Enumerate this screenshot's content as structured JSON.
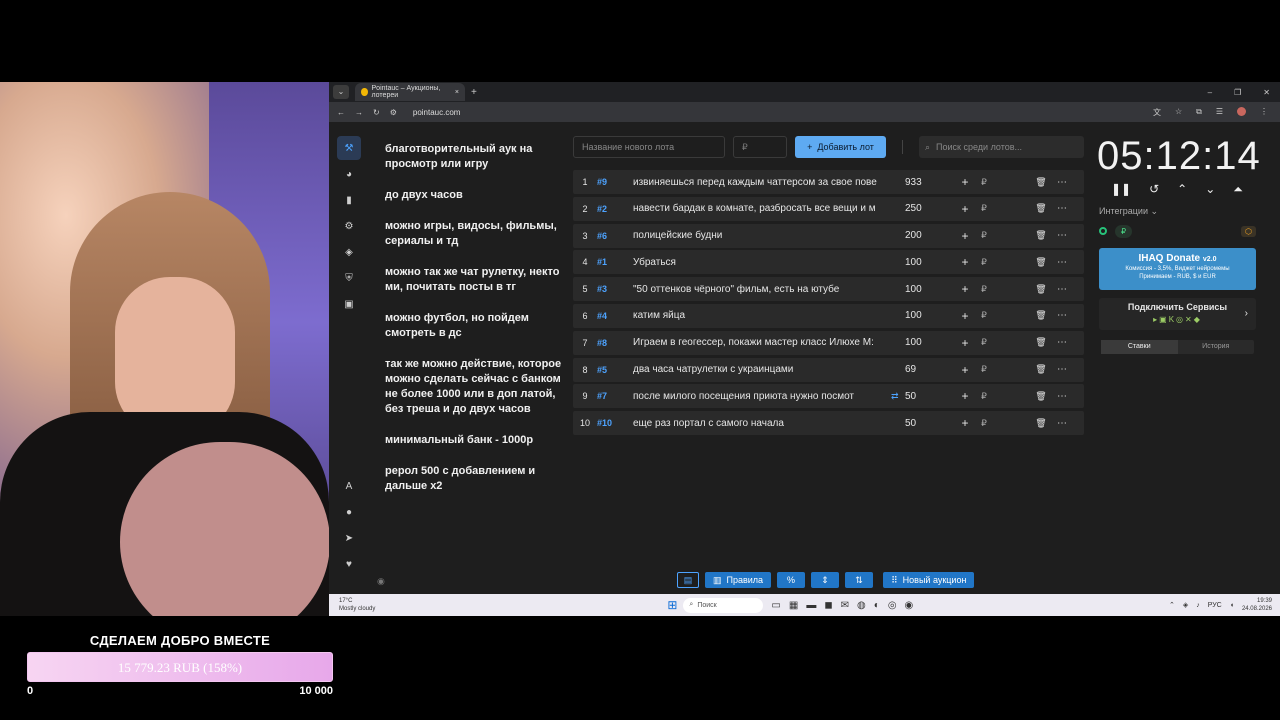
{
  "donation": {
    "title": "СДЕЛАЕМ ДОБРО ВМЕСТЕ",
    "progress_text": "15 779.23 RUB (158%)",
    "progress_percent": 158,
    "min": "0",
    "max": "10 000"
  },
  "browser": {
    "tab_title": "Pointauc – Аукционы, лотереи",
    "url": "pointauc.com"
  },
  "rules": [
    "благотворительный аук на просмотр или игру",
    "до  двух часов",
    "можно игры, видосы, фильмы, сериалы и тд",
    "можно так же чат рулетку, некто ми, почитать посты в тг",
    "можно футбол, но пойдем смотреть в дс",
    "так же можно действие, которое можно сделать сейчас с банком не более 1000 или в доп латой, без треша  и до двух часов",
    "минимальный банк - 1000р",
    "рерол 500 с добавлением и дальше х2"
  ],
  "controls": {
    "new_lot_placeholder": "Название нового лота",
    "price_placeholder": "₽",
    "add_label": "Добавить лот",
    "search_placeholder": "Поиск среди лотов..."
  },
  "lots": [
    {
      "idx": "1",
      "num": "#9",
      "name": "извиняешься перед каждым чаттерсом за свое пове",
      "amount": "933",
      "link": false
    },
    {
      "idx": "2",
      "num": "#2",
      "name": "навести бардак в комнате, разбросать все вещи и м",
      "amount": "250",
      "link": false
    },
    {
      "idx": "3",
      "num": "#6",
      "name": "полицейские будни",
      "amount": "200",
      "link": false
    },
    {
      "idx": "4",
      "num": "#1",
      "name": "Убраться",
      "amount": "100",
      "link": false
    },
    {
      "idx": "5",
      "num": "#3",
      "name": "\"50 оттенков чёрного\" фильм, есть на ютубе",
      "amount": "100",
      "link": false
    },
    {
      "idx": "6",
      "num": "#4",
      "name": "катим яйца",
      "amount": "100",
      "link": false
    },
    {
      "idx": "7",
      "num": "#8",
      "name": "Играем в геогессер, покажи мастер класс Илюхе М:",
      "amount": "100",
      "link": false
    },
    {
      "idx": "8",
      "num": "#5",
      "name": "два часа чатрулетки с украинцами",
      "amount": "69",
      "link": false
    },
    {
      "idx": "9",
      "num": "#7",
      "name": "после милого посещения приюта нужно посмот",
      "amount": "50",
      "link": true
    },
    {
      "idx": "10",
      "num": "#10",
      "name": "еще раз портал с самого начала",
      "amount": "50",
      "link": false
    }
  ],
  "timer": "05:12:14",
  "integrations": {
    "label": "Интеграции",
    "donate_title": "IHAQ Donate",
    "donate_version": "v2.0",
    "donate_line1": "Комиссия - 3,5%, Виджет нейромемы",
    "donate_line2": "Принимаем - RUB, $ и EUR",
    "connect_title": "Подключить Сервисы",
    "tab_bets": "Ставки",
    "tab_history": "История"
  },
  "footer": {
    "rules_label": "Правила",
    "new_auction_label": "Новый аукцион"
  },
  "taskbar": {
    "temp": "17°C",
    "weather": "Mostly cloudy",
    "search": "Поиск",
    "lang": "РУС",
    "time": "19:39",
    "date": "24.08.2026"
  },
  "colors": {
    "accent": "#4da3ff",
    "button": "#5eaaf2",
    "footer_button": "#2176c7",
    "progress": "#e7a8ea"
  }
}
